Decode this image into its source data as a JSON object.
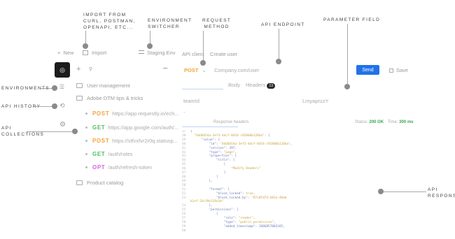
{
  "annotations": {
    "import_from": "IMPORT FROM\ncURL, Postman,\nOpenAPI, etc...",
    "environment_switcher": "ENVIRONMENT\nSWITCHER",
    "request_method": "REQUEST\nMETHOD",
    "api_endpoint": "API ENDPOINT",
    "parameter_field": "PARAMETER FIELD",
    "environments": "ENVIRONMENTS",
    "api_history": "API HISTORY",
    "api_collections": "API\nCOLLECTIONS",
    "api_response": "API\nRESPONSE"
  },
  "topbar": {
    "new_label": "New",
    "import_label": "Import",
    "env_label": "Staging Env",
    "tab_api_client": "API client",
    "tab_create_user": "Create user"
  },
  "sidebar": {
    "more": "•••",
    "folders": [
      {
        "label": "User management"
      },
      {
        "label": "Adobe DTM tips & tricks"
      }
    ],
    "requests": [
      {
        "method": "POST",
        "url": "https://app.requestly.io/ech..."
      },
      {
        "method": "GET",
        "url": "https://app.google.com/auth/..."
      },
      {
        "method": "POST",
        "url": "https://stfvxfvr2r0q.statusp..."
      },
      {
        "method": "GET",
        "url": "/auth/roles"
      },
      {
        "method": "OPT",
        "url": "/auth/refresh-token"
      }
    ],
    "product_folder": "Product catalog"
  },
  "request": {
    "method": "POST",
    "url": "Company.com/user",
    "send_label": "Send",
    "save_label": "Save",
    "tab_body": "Body",
    "tab_headers": "Headers",
    "headers_count": "13",
    "param_key": "teamId",
    "param_value": "LmyaprzzY",
    "param_dash": "-"
  },
  "response": {
    "title": "Response headers",
    "status_label": "Status:",
    "status_value": "200 OK",
    "time_label": "Time:",
    "time_value": "300 ms"
  },
  "colors": {
    "post": "#f3a33c",
    "get": "#4fbf62",
    "opt": "#d763e0",
    "send": "#2172e8",
    "status_ok": "#3aa555"
  }
}
